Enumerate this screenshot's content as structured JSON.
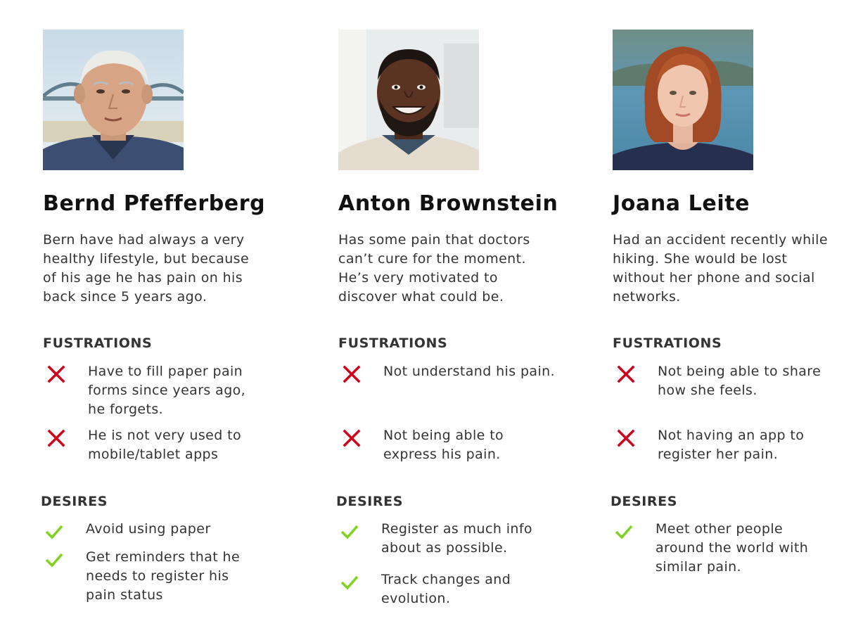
{
  "colors": {
    "frustration_mark": "#d0021b",
    "desire_mark": "#7ed321",
    "text": "#333333"
  },
  "personas": [
    {
      "name": "Bernd Pfefferberg",
      "bio": "Bern have had always a very healthy lifestyle, but because of his age he has pain on his back since 5 years ago.",
      "frustrations_label": "FUSTRATIONS",
      "frustrations": [
        "Have to fill paper pain forms since years ago, he forgets.",
        "He is not very used to mobile/tablet apps"
      ],
      "desires_label": "DESIRES",
      "desires": [
        "Avoid using paper",
        "Get reminders that he needs to register his pain status"
      ]
    },
    {
      "name": "Anton Brownstein",
      "bio": "Has some pain that doctors can’t cure for the moment. He’s very motivated to discover what could be.",
      "frustrations_label": "FUSTRATIONS",
      "frustrations": [
        "Not understand his pain.",
        "Not being able to express his pain."
      ],
      "desires_label": "DESIRES",
      "desires": [
        "Register as much info about as possible.",
        "Track changes and evolution."
      ]
    },
    {
      "name": "Joana Leite",
      "bio": "Had an accident recently while hiking. She would be lost without her phone and social networks.",
      "frustrations_label": "FUSTRATIONS",
      "frustrations": [
        "Not being able to share how she feels.",
        "Not having an app to register her pain."
      ],
      "desires_label": "DESIRES",
      "desires": [
        "Meet other people around the world with similar pain."
      ]
    }
  ]
}
